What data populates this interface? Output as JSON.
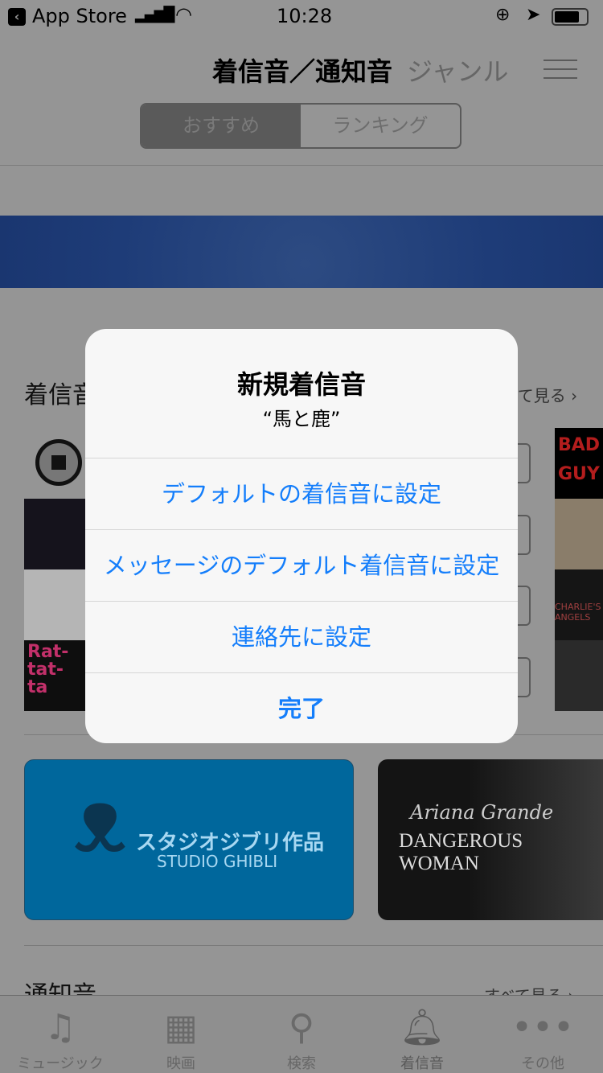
{
  "status_bar": {
    "back_app": "App Store",
    "time": "10:28"
  },
  "nav": {
    "title": "着信音／通知音",
    "genre": "ジャンル"
  },
  "segments": [
    {
      "label": "おすすめ",
      "selected": true
    },
    {
      "label": "ランキング",
      "selected": false
    }
  ],
  "sections": {
    "ringtones": {
      "title": "着信音",
      "see_all": "すべて見る ›"
    },
    "notifications": {
      "title": "通知音",
      "see_all": "すべて見る ›"
    }
  },
  "cards": [
    {
      "title": "スタジオジブリ作品",
      "subtitle": "STUDIO GHIBLI",
      "color": "#00679c"
    },
    {
      "title": "Ariana Grande",
      "subtitle": "DANGEROUS WOMAN"
    }
  ],
  "album_art": {
    "left": [
      "Rat-tat-ta"
    ],
    "right": [
      "BAD GUY",
      "CHARLIE'S ANGELS"
    ]
  },
  "alert": {
    "title": "新規着信音",
    "subtitle": "“馬と鹿”",
    "buttons": [
      "デフォルトの着信音に設定",
      "メッセージのデフォルト着信音に設定",
      "連絡先に設定",
      "完了"
    ],
    "accent": "#147efb"
  },
  "tabs": [
    {
      "label": "ミュージック",
      "icon": "music-note-icon"
    },
    {
      "label": "映画",
      "icon": "film-icon"
    },
    {
      "label": "検索",
      "icon": "search-icon"
    },
    {
      "label": "着信音",
      "icon": "bell-icon",
      "selected": true
    },
    {
      "label": "その他",
      "icon": "more-icon"
    }
  ]
}
